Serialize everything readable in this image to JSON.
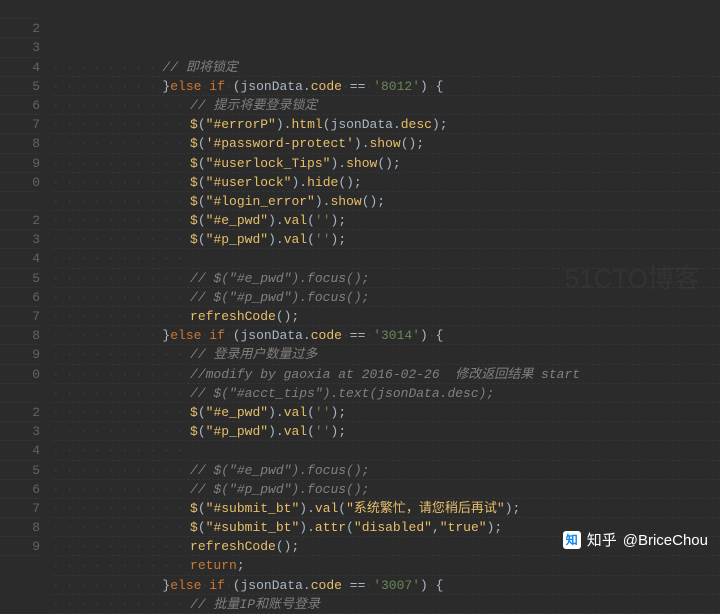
{
  "line_numbers": [
    "",
    "2",
    "3",
    "4",
    "5",
    "6",
    "7",
    "8",
    "9",
    "0",
    "",
    "2",
    "3",
    "4",
    "5",
    "6",
    "7",
    "8",
    "9",
    "0",
    "",
    "2",
    "3",
    "4",
    "5",
    "6",
    "7",
    "8",
    "9"
  ],
  "indent_dots": "·",
  "lines": [
    {
      "indent": 8,
      "tokens": [
        [
          "cmt",
          "// 即将锁定"
        ]
      ]
    },
    {
      "indent": 8,
      "tokens": [
        [
          "pn",
          "}"
        ],
        [
          "kw",
          "else"
        ],
        [
          "ws",
          "·"
        ],
        [
          "kw",
          "if"
        ],
        [
          "ws",
          "·"
        ],
        [
          "pn",
          "("
        ],
        [
          "v",
          "jsonData"
        ],
        [
          "pn",
          "."
        ],
        [
          "prop",
          "code"
        ],
        [
          "ws",
          "·"
        ],
        [
          "pn",
          "=="
        ],
        [
          "ws",
          "·"
        ],
        [
          "str",
          "'8012'"
        ],
        [
          "pn",
          ")"
        ],
        [
          "ws",
          "·"
        ],
        [
          "pn",
          "{"
        ]
      ]
    },
    {
      "indent": 10,
      "tokens": [
        [
          "cmt",
          "// 提示将要登录锁定"
        ]
      ]
    },
    {
      "indent": 10,
      "tokens": [
        [
          "dol",
          "$"
        ],
        [
          "pn",
          "("
        ],
        [
          "strO",
          "\"#errorP\""
        ],
        [
          "pn",
          ")"
        ],
        [
          "pn",
          "."
        ],
        [
          "call",
          "html"
        ],
        [
          "pn",
          "("
        ],
        [
          "v",
          "jsonData"
        ],
        [
          "pn",
          "."
        ],
        [
          "prop",
          "desc"
        ],
        [
          "pn",
          ");"
        ]
      ]
    },
    {
      "indent": 10,
      "tokens": [
        [
          "dol",
          "$"
        ],
        [
          "pn",
          "("
        ],
        [
          "strO",
          "'#password-protect'"
        ],
        [
          "pn",
          ")"
        ],
        [
          "pn",
          "."
        ],
        [
          "call",
          "show"
        ],
        [
          "pn",
          "();"
        ]
      ]
    },
    {
      "indent": 10,
      "tokens": [
        [
          "dol",
          "$"
        ],
        [
          "pn",
          "("
        ],
        [
          "strO",
          "\"#userlock_Tips\""
        ],
        [
          "pn",
          ")"
        ],
        [
          "pn",
          "."
        ],
        [
          "call",
          "show"
        ],
        [
          "pn",
          "();"
        ]
      ]
    },
    {
      "indent": 10,
      "tokens": [
        [
          "dol",
          "$"
        ],
        [
          "pn",
          "("
        ],
        [
          "strO",
          "\"#userlock\""
        ],
        [
          "pn",
          ")"
        ],
        [
          "pn",
          "."
        ],
        [
          "call",
          "hide"
        ],
        [
          "pn",
          "();"
        ]
      ]
    },
    {
      "indent": 10,
      "tokens": [
        [
          "dol",
          "$"
        ],
        [
          "pn",
          "("
        ],
        [
          "strO",
          "\"#login_error\""
        ],
        [
          "pn",
          ")"
        ],
        [
          "pn",
          "."
        ],
        [
          "call",
          "show"
        ],
        [
          "pn",
          "();"
        ]
      ]
    },
    {
      "indent": 10,
      "tokens": [
        [
          "dol",
          "$"
        ],
        [
          "pn",
          "("
        ],
        [
          "strO",
          "\"#e_pwd\""
        ],
        [
          "pn",
          ")"
        ],
        [
          "pn",
          "."
        ],
        [
          "call",
          "val"
        ],
        [
          "pn",
          "("
        ],
        [
          "str",
          "''"
        ],
        [
          "pn",
          ");"
        ]
      ]
    },
    {
      "indent": 10,
      "tokens": [
        [
          "dol",
          "$"
        ],
        [
          "pn",
          "("
        ],
        [
          "strO",
          "\"#p_pwd\""
        ],
        [
          "pn",
          ")"
        ],
        [
          "pn",
          "."
        ],
        [
          "call",
          "val"
        ],
        [
          "pn",
          "("
        ],
        [
          "str",
          "''"
        ],
        [
          "pn",
          ");"
        ]
      ]
    },
    {
      "indent": 10,
      "tokens": []
    },
    {
      "indent": 10,
      "tokens": [
        [
          "cmt",
          "// $(\"#e_pwd\").focus();"
        ]
      ]
    },
    {
      "indent": 10,
      "tokens": [
        [
          "cmt",
          "// $(\"#p_pwd\").focus();"
        ]
      ]
    },
    {
      "indent": 10,
      "tokens": [
        [
          "call",
          "refreshCode"
        ],
        [
          "pn",
          "();"
        ]
      ]
    },
    {
      "indent": 8,
      "tokens": [
        [
          "pn",
          "}"
        ],
        [
          "kw",
          "else"
        ],
        [
          "ws",
          "·"
        ],
        [
          "kw",
          "if"
        ],
        [
          "ws",
          "·"
        ],
        [
          "pn",
          "("
        ],
        [
          "v",
          "jsonData"
        ],
        [
          "pn",
          "."
        ],
        [
          "prop",
          "code"
        ],
        [
          "ws",
          "·"
        ],
        [
          "pn",
          "=="
        ],
        [
          "ws",
          "·"
        ],
        [
          "str",
          "'3014'"
        ],
        [
          "pn",
          ")"
        ],
        [
          "ws",
          "·"
        ],
        [
          "pn",
          "{"
        ]
      ]
    },
    {
      "indent": 10,
      "tokens": [
        [
          "cmt",
          "// 登录用户数量过多"
        ]
      ]
    },
    {
      "indent": 10,
      "tokens": [
        [
          "cmt",
          "//modify by gaoxia at 2016-02-26  修改返回结果 start"
        ]
      ]
    },
    {
      "indent": 10,
      "tokens": [
        [
          "cmt",
          "// $(\"#acct_tips\").text(jsonData.desc);"
        ]
      ]
    },
    {
      "indent": 10,
      "tokens": [
        [
          "dol",
          "$"
        ],
        [
          "pn",
          "("
        ],
        [
          "strO",
          "\"#e_pwd\""
        ],
        [
          "pn",
          ")"
        ],
        [
          "pn",
          "."
        ],
        [
          "call",
          "val"
        ],
        [
          "pn",
          "("
        ],
        [
          "str",
          "''"
        ],
        [
          "pn",
          ");"
        ]
      ]
    },
    {
      "indent": 10,
      "tokens": [
        [
          "dol",
          "$"
        ],
        [
          "pn",
          "("
        ],
        [
          "strO",
          "\"#p_pwd\""
        ],
        [
          "pn",
          ")"
        ],
        [
          "pn",
          "."
        ],
        [
          "call",
          "val"
        ],
        [
          "pn",
          "("
        ],
        [
          "str",
          "''"
        ],
        [
          "pn",
          ");"
        ]
      ]
    },
    {
      "indent": 10,
      "tokens": []
    },
    {
      "indent": 10,
      "tokens": [
        [
          "cmt",
          "// $(\"#e_pwd\").focus();"
        ]
      ]
    },
    {
      "indent": 10,
      "tokens": [
        [
          "cmt",
          "// $(\"#p_pwd\").focus();"
        ]
      ]
    },
    {
      "indent": 10,
      "tokens": [
        [
          "dol",
          "$"
        ],
        [
          "pn",
          "("
        ],
        [
          "strO",
          "\"#submit_bt\""
        ],
        [
          "pn",
          ")"
        ],
        [
          "pn",
          "."
        ],
        [
          "call",
          "val"
        ],
        [
          "pn",
          "("
        ],
        [
          "strO",
          "\"系统繁忙，请您稍后再试\""
        ],
        [
          "pn",
          ");"
        ]
      ]
    },
    {
      "indent": 10,
      "tokens": [
        [
          "dol",
          "$"
        ],
        [
          "pn",
          "("
        ],
        [
          "strO",
          "\"#submit_bt\""
        ],
        [
          "pn",
          ")"
        ],
        [
          "pn",
          "."
        ],
        [
          "call",
          "attr"
        ],
        [
          "pn",
          "("
        ],
        [
          "strO",
          "\"disabled\""
        ],
        [
          "pn",
          ","
        ],
        [
          "strO",
          "\"true\""
        ],
        [
          "pn",
          ");"
        ]
      ]
    },
    {
      "indent": 10,
      "tokens": [
        [
          "call",
          "refreshCode"
        ],
        [
          "pn",
          "();"
        ]
      ]
    },
    {
      "indent": 10,
      "tokens": [
        [
          "kw",
          "return"
        ],
        [
          "pn",
          ";"
        ]
      ]
    },
    {
      "indent": 8,
      "tokens": [
        [
          "pn",
          "}"
        ],
        [
          "kw",
          "else"
        ],
        [
          "ws",
          "·"
        ],
        [
          "kw",
          "if"
        ],
        [
          "ws",
          "·"
        ],
        [
          "pn",
          "("
        ],
        [
          "v",
          "jsonData"
        ],
        [
          "pn",
          "."
        ],
        [
          "prop",
          "code"
        ],
        [
          "ws",
          "·"
        ],
        [
          "pn",
          "=="
        ],
        [
          "ws",
          "·"
        ],
        [
          "str",
          "'3007'"
        ],
        [
          "pn",
          ")"
        ],
        [
          "ws",
          "·"
        ],
        [
          "pn",
          "{"
        ]
      ]
    },
    {
      "indent": 10,
      "tokens": [
        [
          "cmt",
          "// 批量IP和账号登录"
        ]
      ]
    }
  ],
  "watermark": {
    "brand": "知乎",
    "user": "@BriceChou",
    "icon_text": "知"
  },
  "bg_watermark": "51CTO博客"
}
